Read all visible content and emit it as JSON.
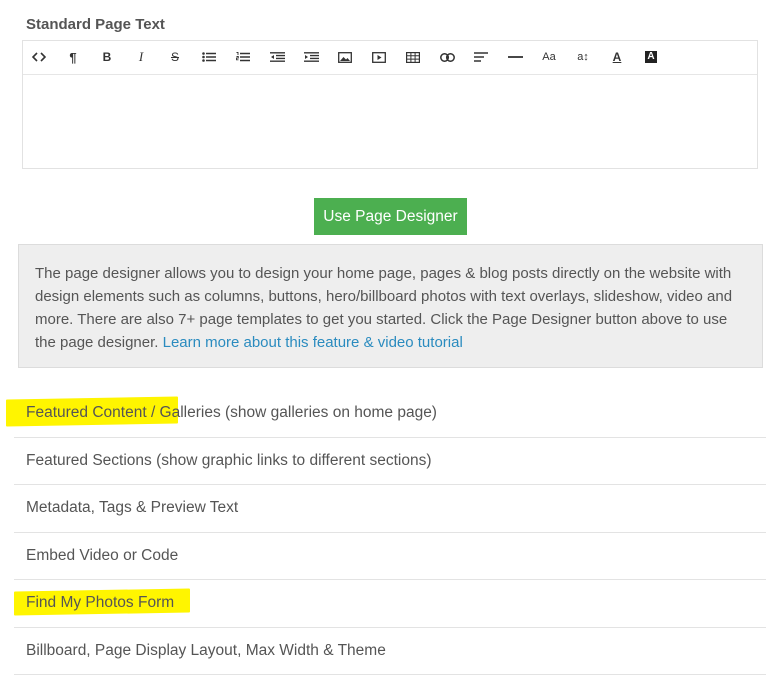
{
  "section": {
    "title": "Standard Page Text"
  },
  "toolbar": {
    "items": [
      {
        "name": "code-view-icon",
        "glyph": "<>"
      },
      {
        "name": "paragraph-icon",
        "glyph": "¶"
      },
      {
        "name": "bold-icon",
        "glyph": "B"
      },
      {
        "name": "italic-icon",
        "glyph": "I"
      },
      {
        "name": "strikethrough-icon",
        "glyph": "S"
      },
      {
        "name": "bullet-list-icon",
        "glyph": "ul"
      },
      {
        "name": "numbered-list-icon",
        "glyph": "ol"
      },
      {
        "name": "outdent-icon",
        "glyph": "out"
      },
      {
        "name": "indent-icon",
        "glyph": "in"
      },
      {
        "name": "image-icon",
        "glyph": "img"
      },
      {
        "name": "video-icon",
        "glyph": "vid"
      },
      {
        "name": "table-icon",
        "glyph": "tbl"
      },
      {
        "name": "link-icon",
        "glyph": "lnk"
      },
      {
        "name": "align-icon",
        "glyph": "aln"
      },
      {
        "name": "horizontal-rule-icon",
        "glyph": "hr"
      },
      {
        "name": "font-size-icon",
        "glyph": "Aa"
      },
      {
        "name": "line-height-icon",
        "glyph": "a↕"
      },
      {
        "name": "font-color-icon",
        "glyph": "A"
      },
      {
        "name": "background-color-icon",
        "glyph": "A"
      }
    ]
  },
  "designer_button": {
    "label": "Use Page Designer"
  },
  "info": {
    "text": "The page designer allows you to design your home page, pages & blog posts directly on the website with design elements such as columns, buttons, hero/billboard photos with text overlays, slideshow, video and more. There are also 7+ page templates to get you started. Click the Page Designer button above to use the page designer. ",
    "link": "Learn more about this feature & video tutorial"
  },
  "accordion": {
    "items": [
      {
        "label": "Featured Content / Galleries (show galleries on home page)",
        "highlighted": true
      },
      {
        "label": "Featured Sections (show graphic links to different sections)",
        "highlighted": false
      },
      {
        "label": "Metadata, Tags & Preview Text",
        "highlighted": false
      },
      {
        "label": "Embed Video or Code",
        "highlighted": false
      },
      {
        "label": "Find My Photos Form",
        "highlighted": true
      },
      {
        "label": "Billboard, Page Display Layout, Max Width & Theme",
        "highlighted": false
      }
    ]
  },
  "colors": {
    "button_green": "#4caf50",
    "link_blue": "#2a8bbf",
    "highlight_yellow": "#fff500",
    "info_background": "#eeeeee"
  }
}
